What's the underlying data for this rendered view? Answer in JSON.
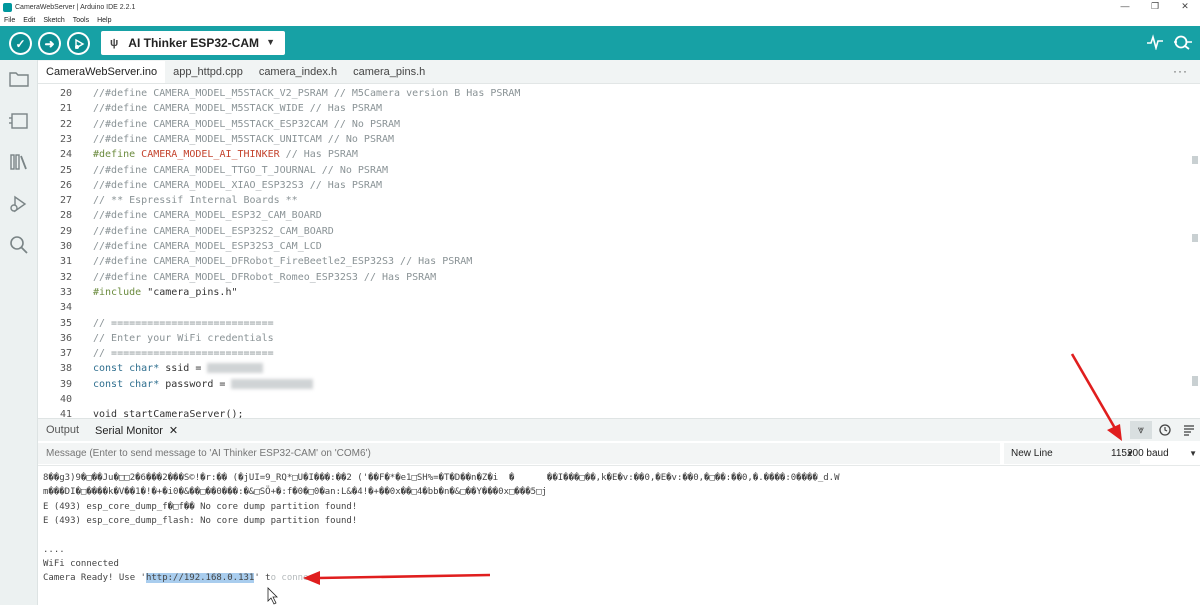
{
  "window": {
    "title": "CameraWebServer | Arduino IDE 2.2.1",
    "controls": [
      "—",
      "❐",
      "✕"
    ]
  },
  "menu": [
    "File",
    "Edit",
    "Sketch",
    "Tools",
    "Help"
  ],
  "toolbar": {
    "board": "AI Thinker ESP32-CAM",
    "colors": {
      "teal": "#17a1a5",
      "dark_teal": "#0c8e92"
    }
  },
  "sidebar_icons": [
    "folder-icon",
    "board-icon",
    "library-icon",
    "debug-icon",
    "search-icon"
  ],
  "tabs": [
    "CameraWebServer.ino",
    "app_httpd.cpp",
    "camera_index.h",
    "camera_pins.h"
  ],
  "editor": {
    "lines": [
      {
        "n": "20",
        "t": "//#define CAMERA_MODEL_M5STACK_V2_PSRAM // M5Camera version B Has PSRAM"
      },
      {
        "n": "21",
        "t": "//#define CAMERA_MODEL_M5STACK_WIDE // Has PSRAM"
      },
      {
        "n": "22",
        "t": "//#define CAMERA_MODEL_M5STACK_ESP32CAM // No PSRAM"
      },
      {
        "n": "23",
        "t": "//#define CAMERA_MODEL_M5STACK_UNITCAM // No PSRAM"
      },
      {
        "n": "24",
        "pre": "#define ",
        "mid": "CAMERA_MODEL_AI_THINKER",
        "post": " // Has PSRAM"
      },
      {
        "n": "25",
        "t": "//#define CAMERA_MODEL_TTGO_T_JOURNAL // No PSRAM"
      },
      {
        "n": "26",
        "t": "//#define CAMERA_MODEL_XIAO_ESP32S3 // Has PSRAM"
      },
      {
        "n": "27",
        "t": "// ** Espressif Internal Boards **"
      },
      {
        "n": "28",
        "t": "//#define CAMERA_MODEL_ESP32_CAM_BOARD"
      },
      {
        "n": "29",
        "t": "//#define CAMERA_MODEL_ESP32S2_CAM_BOARD"
      },
      {
        "n": "30",
        "t": "//#define CAMERA_MODEL_ESP32S3_CAM_LCD"
      },
      {
        "n": "31",
        "t": "//#define CAMERA_MODEL_DFRobot_FireBeetle2_ESP32S3 // Has PSRAM"
      },
      {
        "n": "32",
        "t": "//#define CAMERA_MODEL_DFRobot_Romeo_ESP32S3 // Has PSRAM"
      },
      {
        "n": "33",
        "pre": "#include ",
        "mid": "\"camera_pins.h\"",
        "post": ""
      },
      {
        "n": "34",
        "t": ""
      },
      {
        "n": "35",
        "t": "// ==========================="
      },
      {
        "n": "36",
        "t": "// Enter your WiFi credentials"
      },
      {
        "n": "37",
        "t": "// ==========================="
      },
      {
        "n": "38",
        "pre": "const char* ",
        "mid": "ssid = ",
        "post": ""
      },
      {
        "n": "39",
        "pre": "const char* ",
        "mid": "password = ",
        "post": ""
      },
      {
        "n": "40",
        "t": ""
      },
      {
        "n": "41",
        "t": "void startCameraServer();"
      }
    ]
  },
  "panel": {
    "tabs": [
      "Output",
      "Serial Monitor"
    ],
    "input_placeholder": "Message (Enter to send message to 'AI Thinker ESP32-CAM' on 'COM6')",
    "line_ending": "New Line",
    "baud": "115200 baud",
    "output": {
      "garbage1": "8��g3)9�□��Ju�□□2�6���2���S©!�r:�� (�jUI=9_RQ*□U�I���:��2 ('��F�*�e1□SH%=�T�D��n�Z�i  �      ��I���□��,k�E�v:��0,�E�v:��0,�□��:��0,�.����:0����_d.W",
      "garbage2": "m���DI�□����k�V��1�!�+�i0�&��□��0���:�&□SÖ+�:f�0�□0�an:L&�4!�+��0x��□4�bb�n�&□��Y���0x□���5□j",
      "err1": "E (493) esp_core_dump_f�□f�� No core dump partition found!",
      "err2": "E (493) esp_core_dump_flash: No core dump partition found!",
      "dots": "....",
      "wifi": "WiFi connected",
      "ready_prefix": "Camera Ready! Use '",
      "ready_url": "http://192.168.0.131",
      "ready_suffix": "' t",
      "ready_tail": "o connect"
    }
  }
}
